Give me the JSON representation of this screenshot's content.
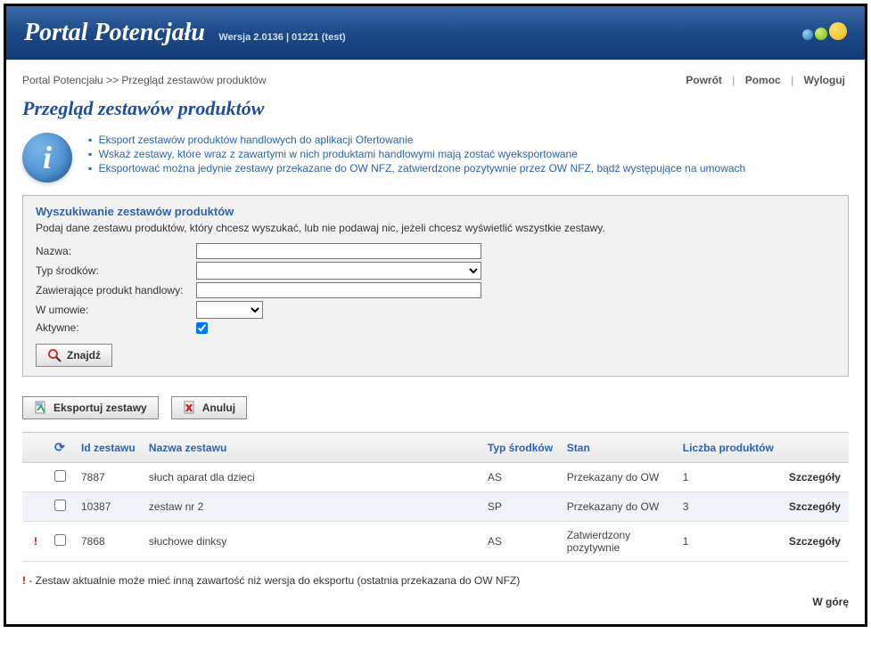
{
  "header": {
    "title": "Portal Potencjału",
    "version": "Wersja 2.0136 | 01221 (test)"
  },
  "breadcrumb": "Portal Potencjału >> Przegląd zestawów produktów",
  "top_links": {
    "back": "Powrót",
    "help": "Pomoc",
    "logout": "Wyloguj"
  },
  "page_title": "Przegląd zestawów produktów",
  "info_items": [
    "Eksport zestawów produktów handlowych do aplikacji Ofertowanie",
    "Wskaż zestawy, które wraz z zawartymi w nich produktami handlowymi mają zostać wyeksportowane",
    "Eksportować można jedynie zestawy przekazane do OW NFZ, zatwierdzone pozytywnie przez OW NFZ, bądź występujące na umowach"
  ],
  "search": {
    "title": "Wyszukiwanie zestawów produktów",
    "desc": "Podaj dane zestawu produktów, który chcesz wyszukać, lub nie podawaj nic, jeżeli chcesz wyświetlić wszystkie zestawy.",
    "labels": {
      "name": "Nazwa:",
      "type": "Typ środków:",
      "containing": "Zawierające produkt handlowy:",
      "contract": "W umowie:",
      "active": "Aktywne:"
    },
    "values": {
      "name": "",
      "type": "",
      "containing": "",
      "contract": "",
      "active": true
    },
    "find_btn": "Znajdź"
  },
  "actions": {
    "export": "Eksportuj zestawy",
    "cancel": "Anuluj"
  },
  "table": {
    "headers": {
      "id": "Id zestawu",
      "name": "Nazwa zestawu",
      "type": "Typ środków",
      "state": "Stan",
      "count": "Liczba produktów"
    },
    "details_label": "Szczegóły",
    "rows": [
      {
        "alert": false,
        "id": "7887",
        "name": "słuch aparat dla dzieci",
        "type": "AS",
        "state": "Przekazany do OW",
        "count": "1"
      },
      {
        "alert": false,
        "id": "10387",
        "name": "zestaw nr 2",
        "type": "SP",
        "state": "Przekazany do OW",
        "count": "3"
      },
      {
        "alert": true,
        "id": "7868",
        "name": "słuchowe dinksy",
        "type": "AS",
        "state": "Zatwierdzony pozytywnie",
        "count": "1"
      }
    ]
  },
  "footnote": {
    "mark": "!",
    "text": " - Zestaw aktualnie może mieć inną zawartość niż wersja do eksportu (ostatnia przekazana do OW NFZ)"
  },
  "gotop": "W górę"
}
